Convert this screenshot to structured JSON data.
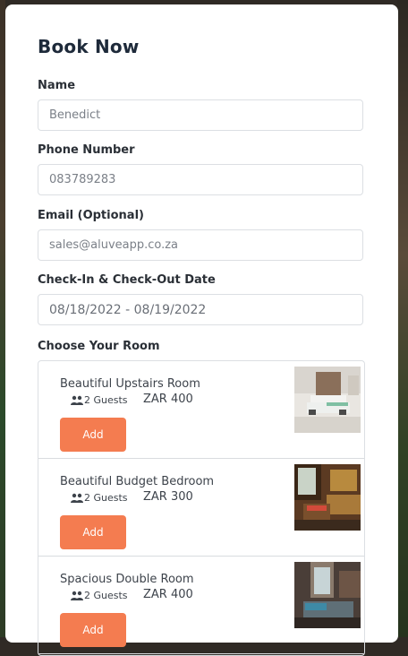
{
  "form": {
    "title": "Book Now",
    "name_label": "Name",
    "name_value": "Benedict",
    "phone_label": "Phone Number",
    "phone_value": "083789283",
    "email_label": "Email (Optional)",
    "email_value": "sales@aluveapp.co.za",
    "dates_label": "Check-In & Check-Out Date",
    "dates_value": "08/18/2022 - 08/19/2022",
    "rooms_label": "Choose Your Room"
  },
  "rooms": [
    {
      "name": "Beautiful Upstairs Room",
      "guests": "2 Guests",
      "price": "ZAR 400",
      "button": "Add"
    },
    {
      "name": "Beautiful Budget Bedroom",
      "guests": "2 Guests",
      "price": "ZAR 300",
      "button": "Add"
    },
    {
      "name": "Spacious Double Room",
      "guests": "2 Guests",
      "price": "ZAR 400",
      "button": "Add"
    }
  ],
  "colors": {
    "accent": "#f47c50",
    "title": "#1e2a3a",
    "border": "#dcdfe3"
  },
  "icons": {
    "guests": "users-icon"
  }
}
